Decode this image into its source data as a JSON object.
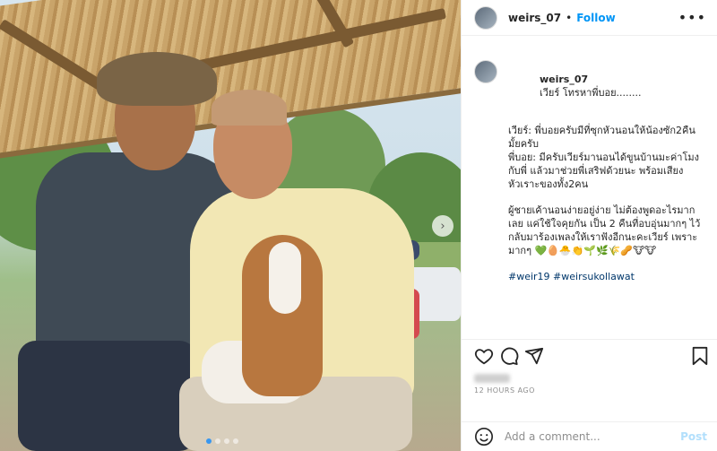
{
  "header": {
    "username": "weirs_07",
    "separator": "•",
    "follow_label": "Follow",
    "more_label": "•••"
  },
  "caption": {
    "username": "weirs_07",
    "title": "เวียร์ โทรหาพี่บอย........",
    "paragraph1": "เวียร์: พี่บอยครับมีที่ซุกหัวนอนให้น้องซัก2คืนมั้ยครับ\nพี่บอย: มีครับเวียร์มานอนได้ขูนบ้านมะค่าโมงกับพี่ แล้วมาช่วยพี่เสริฟด้วยนะ พร้อมเสียงหัวเราะของทั้ง2คน",
    "paragraph2": "ผู้ชายเค้านอนง่ายอยู่ง่าย ไม่ต้องพูดอะไรมากเลย แค่ใช้ใจคุยกัน เป็น 2 คืนที่อบอุ่นมากๆ ไว้กลับมาร้องเพลงให้เราฟังอีกนะคะเวียร์ เพราะมากๆ 💚🥚🐣👏🌱🌿🌾🥜🐮🐮",
    "hashtags": "#weir19 #weirsukollawat"
  },
  "actions": {
    "timestamp": "12 HOURS AGO"
  },
  "comment": {
    "placeholder": "Add a comment...",
    "post_label": "Post"
  },
  "photo": {
    "next_label": "›",
    "carousel_total": 4,
    "carousel_active": 1
  },
  "colors": {
    "follow_blue": "#0095f6",
    "post_disabled": "#b2dffc",
    "hashtag": "#00376b",
    "muted": "#8e8e8e"
  },
  "icons": [
    "heart-icon",
    "comment-icon",
    "share-icon",
    "bookmark-icon",
    "emoji-icon",
    "more-icon",
    "chevron-right-icon"
  ]
}
